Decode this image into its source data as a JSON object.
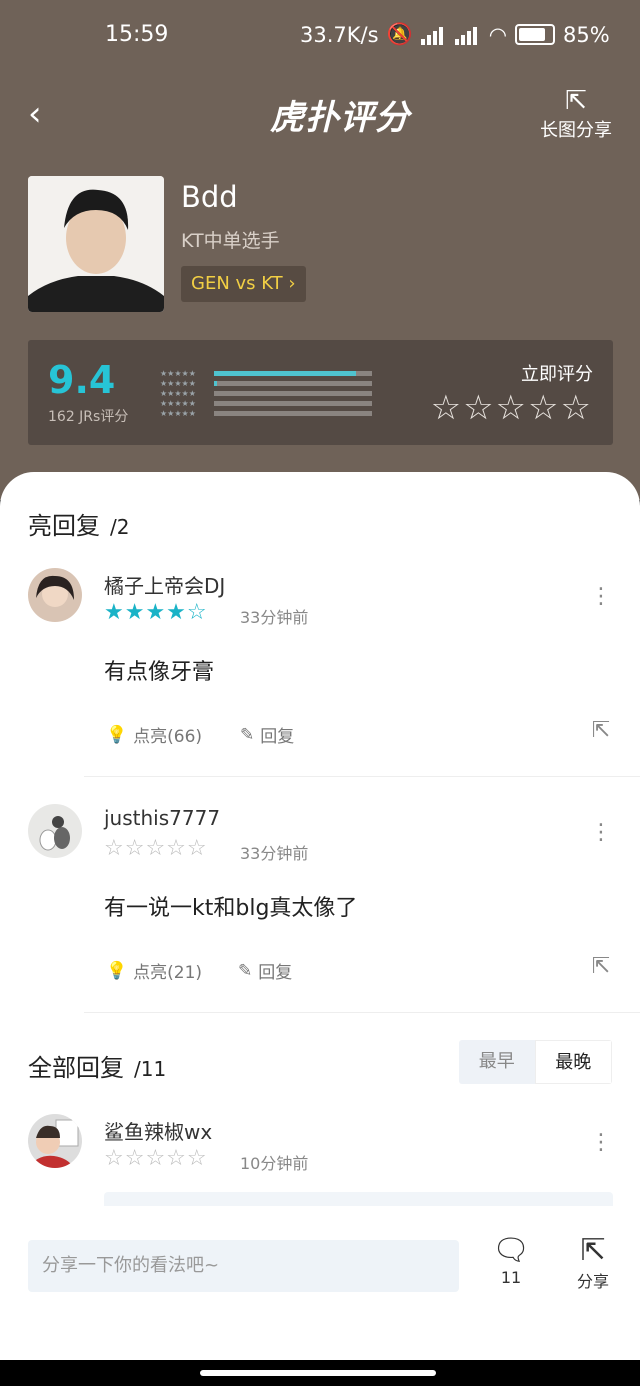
{
  "status": {
    "time": "15:59",
    "speed": "33.7K/s",
    "battery": "85%"
  },
  "nav": {
    "back": "‹",
    "logo": "虎扑评分",
    "share_icon": "⇱",
    "share_label": "长图分享"
  },
  "player": {
    "name": "Bdd",
    "role": "KT中单选手",
    "match": "GEN vs KT ›"
  },
  "rating": {
    "score": "9.4",
    "count": "162 JRs评分",
    "rate_label": "立即评分",
    "rate_stars": "☆☆☆☆☆",
    "distribution": [
      0.9,
      0.02,
      0.0,
      0.0,
      0.0
    ]
  },
  "highlight": {
    "title": "亮回复",
    "count": "/2"
  },
  "comments": [
    {
      "user": "橘子上帝会DJ",
      "stars_filled": "★★★★",
      "stars_empty": "☆",
      "time": "33分钟前",
      "text": "有点像牙膏",
      "like": "点亮(66)",
      "reply": "回复"
    },
    {
      "user": "justhis7777",
      "stars_filled": "",
      "stars_empty": "☆☆☆☆☆",
      "time": "33分钟前",
      "text": "有一说一kt和blg真太像了",
      "like": "点亮(21)",
      "reply": "回复"
    }
  ],
  "all": {
    "title": "全部回复",
    "count": "/11",
    "sort_early": "最早",
    "sort_late": "最晚"
  },
  "latest": {
    "user": "鲨鱼辣椒wx",
    "stars_empty": "☆☆☆☆☆",
    "time": "10分钟前"
  },
  "bottom": {
    "placeholder": "分享一下你的看法吧~",
    "comment_count": "11",
    "share_label": "分享"
  },
  "colors": {
    "header_bg": "#6f6258",
    "accent": "#27c4d6",
    "match_tag": "#f2cf44"
  }
}
